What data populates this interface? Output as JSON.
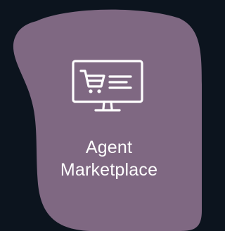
{
  "tile": {
    "label_line_1": "Agent",
    "label_line_2": "Marketplace",
    "icon": "shopping-cart-monitor-icon"
  },
  "colors": {
    "background": "#0c141e",
    "tile": "#7f6882",
    "text": "#ffffff"
  }
}
